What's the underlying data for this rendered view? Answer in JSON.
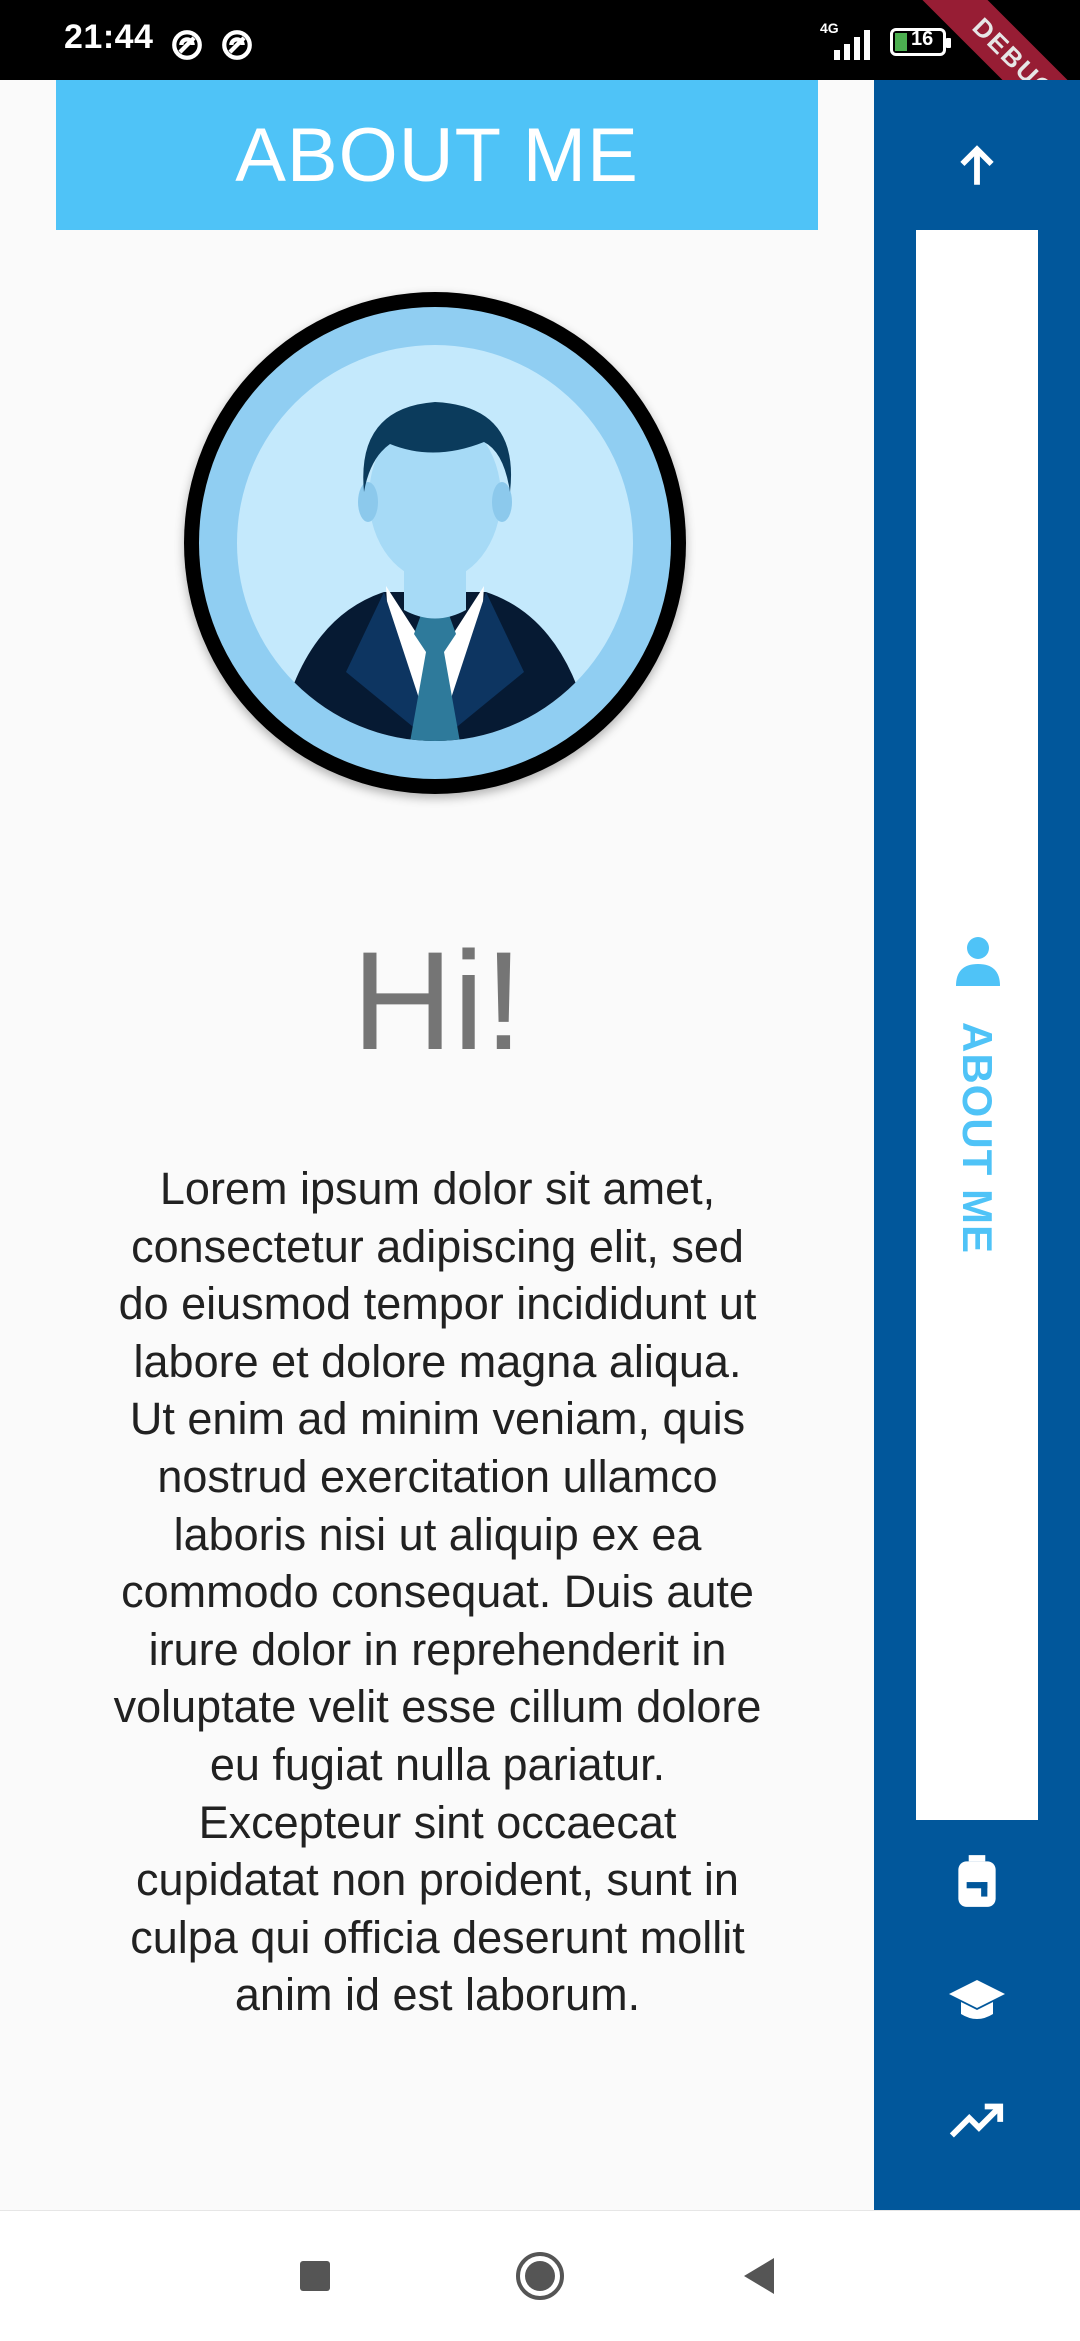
{
  "status_bar": {
    "time": "21:44",
    "network": "4G",
    "battery": "16",
    "debug_banner": "DEBUG"
  },
  "header": {
    "title": "ABOUT ME"
  },
  "profile": {
    "greeting": "Hi!",
    "bio": "Lorem ipsum dolor sit amet, consectetur adipiscing elit, sed do eiusmod tempor incididunt ut labore et dolore magna aliqua. Ut enim ad minim veniam, quis nostrud exercitation ullamco laboris nisi ut aliquip ex ea commodo consequat. Duis aute irure dolor in reprehenderit in voluptate velit esse cillum dolore eu fugiat nulla pariatur. Excepteur sint occaecat cupidatat non proident, sunt in culpa qui officia deserunt mollit anim id est laborum."
  },
  "sidebar": {
    "active_label": "ABOUT ME",
    "items": [
      {
        "icon": "arrow-up-icon"
      },
      {
        "icon": "person-icon",
        "label": "ABOUT ME",
        "active": true
      },
      {
        "icon": "backpack-icon"
      },
      {
        "icon": "graduation-cap-icon"
      },
      {
        "icon": "trending-up-icon"
      }
    ]
  },
  "colors": {
    "header_bg": "#4fc3f7",
    "sidebar_bg": "#01579b",
    "accent": "#4fc3f7",
    "text_dark": "#212121",
    "text_gray": "#757575"
  },
  "nav_bar": {
    "buttons": [
      "recents-icon",
      "home-icon",
      "back-icon"
    ]
  }
}
